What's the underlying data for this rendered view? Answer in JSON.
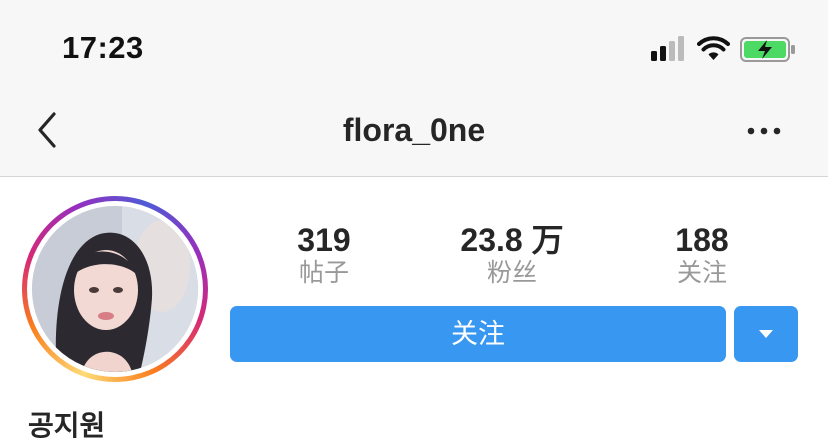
{
  "status_bar": {
    "time": "17:23",
    "icons": [
      "signal-icon",
      "wifi-icon",
      "battery-charging-icon"
    ],
    "battery_color": "#4cd964"
  },
  "nav": {
    "title": "flora_0ne",
    "back_icon": "chevron-left-icon",
    "more_icon": "more-horizontal-icon"
  },
  "profile": {
    "avatar_icon": "profile-avatar",
    "stats": {
      "posts": {
        "value": "319",
        "label": "帖子"
      },
      "followers": {
        "value": "23.8 万",
        "label": "粉丝"
      },
      "following": {
        "value": "188",
        "label": "关注"
      }
    },
    "follow_label": "关注",
    "dropdown_icon": "caret-down-icon",
    "name": "공지원",
    "accent_color": "#3897f0"
  }
}
